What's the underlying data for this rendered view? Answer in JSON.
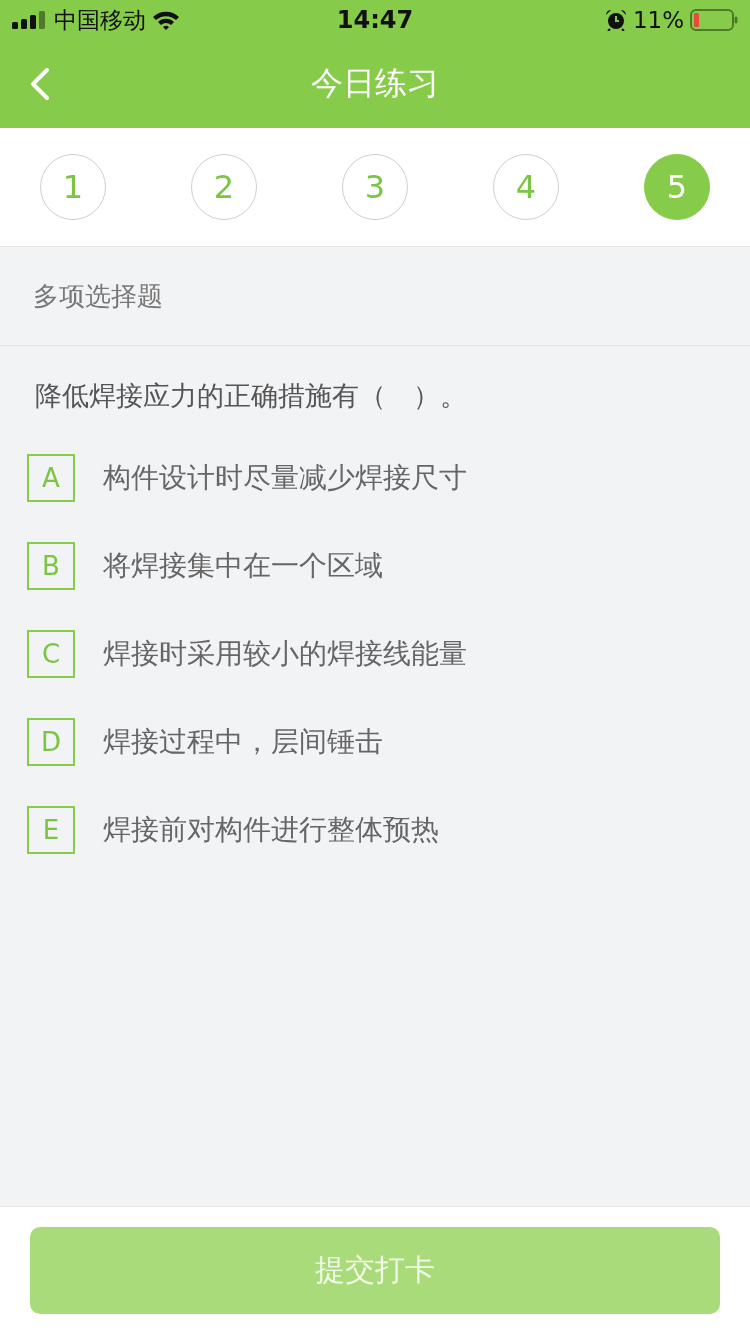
{
  "status_bar": {
    "carrier": "中国移动",
    "time": "14:47",
    "battery": "11%"
  },
  "header": {
    "title": "今日练习"
  },
  "steps": [
    {
      "label": "1",
      "selected": false
    },
    {
      "label": "2",
      "selected": false
    },
    {
      "label": "3",
      "selected": false
    },
    {
      "label": "4",
      "selected": false
    },
    {
      "label": "5",
      "selected": true
    }
  ],
  "section": {
    "title": "多项选择题"
  },
  "question": {
    "text": "降低焊接应力的正确措施有（　）。",
    "options": [
      {
        "letter": "A",
        "text": "构件设计时尽量减少焊接尺寸",
        "selected": false
      },
      {
        "letter": "B",
        "text": "将焊接集中在一个区域",
        "selected": false
      },
      {
        "letter": "C",
        "text": "焊接时采用较小的焊接线能量",
        "selected": false
      },
      {
        "letter": "D",
        "text": "焊接过程中，层间锤击",
        "selected": false
      },
      {
        "letter": "E",
        "text": "焊接前对构件进行整体预热",
        "selected": false
      }
    ]
  },
  "submit": {
    "label": "提交打卡",
    "disabled": true
  }
}
